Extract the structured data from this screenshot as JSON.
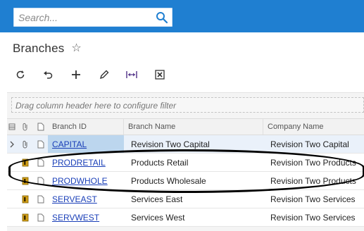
{
  "search": {
    "placeholder": "Search..."
  },
  "page": {
    "title": "Branches"
  },
  "toolbar": {
    "buttons": [
      {
        "name": "refresh-icon"
      },
      {
        "name": "undo-icon"
      },
      {
        "name": "add-icon"
      },
      {
        "name": "edit-icon"
      },
      {
        "name": "fit-columns-icon"
      },
      {
        "name": "export-excel-icon"
      }
    ]
  },
  "filter": {
    "hint": "Drag column header here to configure filter"
  },
  "grid": {
    "columns": {
      "branch_id": "Branch ID",
      "branch_name": "Branch Name",
      "company_name": "Company Name"
    },
    "rows": [
      {
        "branch_id": "CAPITAL",
        "branch_name": "Revision Two Capital",
        "company_name": "Revision Two Capital",
        "selected": true
      },
      {
        "branch_id": "PRODRETAIL",
        "branch_name": "Products Retail",
        "company_name": "Revision Two Products",
        "selected": false
      },
      {
        "branch_id": "PRODWHOLE",
        "branch_name": "Products Wholesale",
        "company_name": "Revision Two Products",
        "selected": false
      },
      {
        "branch_id": "SERVEAST",
        "branch_name": "Services East",
        "company_name": "Revision Two Services",
        "selected": false
      },
      {
        "branch_id": "SERVWEST",
        "branch_name": "Services West",
        "company_name": "Revision Two Services",
        "selected": false
      }
    ]
  },
  "colors": {
    "topbar": "#1f7fd1",
    "link": "#1a3fb8",
    "selected_row": "#eaf1fa",
    "selected_cell": "#bcd6ee",
    "note_icon": "#d4a017"
  }
}
